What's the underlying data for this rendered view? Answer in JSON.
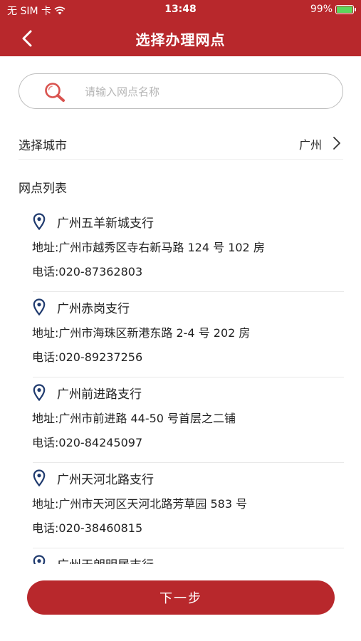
{
  "status_bar": {
    "carrier": "无 SIM 卡",
    "time": "13:48",
    "battery_percent": "99%",
    "battery_level": 0.99
  },
  "nav": {
    "title": "选择办理网点",
    "back_icon": "chevron-left-icon"
  },
  "search": {
    "placeholder": "请输入网点名称",
    "value": "",
    "icon": "search-icon"
  },
  "city": {
    "label": "选择城市",
    "value": "广州"
  },
  "list": {
    "title": "网点列表",
    "items": [
      {
        "name": "广州五羊新城支行",
        "address": "地址:广州市越秀区寺右新马路 124 号 102 房",
        "phone": "电话:020-87362803"
      },
      {
        "name": "广州赤岗支行",
        "address": "地址:广州市海珠区新港东路 2-4 号 202 房",
        "phone": "电话:020-89237256"
      },
      {
        "name": "广州前进路支行",
        "address": "地址:广州市前进路 44-50 号首层之二铺",
        "phone": "电话:020-84245097"
      },
      {
        "name": "广州天河北路支行",
        "address": "地址:广州市天河区天河北路芳草园 583 号",
        "phone": "电话:020-38460815"
      },
      {
        "name": "广州天朗明居支行"
      }
    ]
  },
  "footer": {
    "next_label": "下一步"
  },
  "colors": {
    "brand": "#b8282c",
    "pin": "#1f3a6e",
    "search_icon": "#d9534f"
  }
}
